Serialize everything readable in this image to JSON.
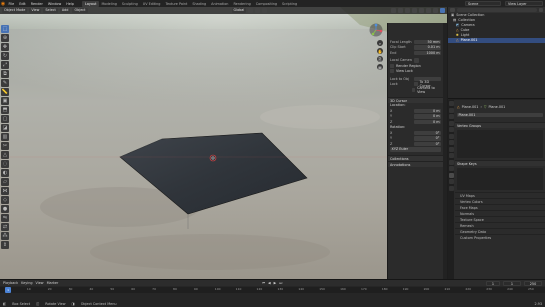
{
  "menu": [
    "File",
    "Edit",
    "Render",
    "Window",
    "Help"
  ],
  "workspaces": [
    {
      "label": "Layout",
      "active": true
    },
    {
      "label": "Modeling",
      "active": false
    },
    {
      "label": "Sculpting",
      "active": false
    },
    {
      "label": "UV Editing",
      "active": false
    },
    {
      "label": "Texture Paint",
      "active": false
    },
    {
      "label": "Shading",
      "active": false
    },
    {
      "label": "Animation",
      "active": false
    },
    {
      "label": "Rendering",
      "active": false
    },
    {
      "label": "Compositing",
      "active": false
    },
    {
      "label": "Scripting",
      "active": false
    }
  ],
  "topright": {
    "scene": "Scene",
    "view_layer": "View Layer"
  },
  "viewport_header": {
    "mode": "Object Mode",
    "view": "View",
    "select": "Select",
    "add": "Add",
    "object": "Object",
    "orientation": "Global"
  },
  "npanel": {
    "lens": [
      {
        "label": "Focal Length",
        "value": "50 mm"
      },
      {
        "label": "Clip Start",
        "value": "0.01 m"
      },
      {
        "label": "End",
        "value": "1000 m"
      }
    ],
    "local_camera": "Local Camera",
    "render_region": "Render Region",
    "view_lock": "View Lock",
    "lock_to_object": "Lock to Obj",
    "lock": "Lock",
    "to_3d_cursor": "To 3D Cursor",
    "camera_to_view": "Camera to View",
    "cursor_section": "3D Cursor",
    "location_label": "Location:",
    "location": [
      {
        "axis": "X",
        "value": "0 m"
      },
      {
        "axis": "Y",
        "value": "0 m"
      },
      {
        "axis": "Z",
        "value": "0 m"
      }
    ],
    "rotation_label": "Rotation:",
    "rotation": [
      {
        "axis": "X",
        "value": "0°"
      },
      {
        "axis": "Y",
        "value": "0°"
      },
      {
        "axis": "Z",
        "value": "0°"
      }
    ],
    "rotation_mode": "XYZ Euler",
    "collections": "Collections",
    "annotations": "Annotations"
  },
  "outliner": {
    "title": "Scene Collection",
    "rows": [
      {
        "label": "Collection",
        "selected": false
      },
      {
        "label": "Camera",
        "selected": false
      },
      {
        "label": "Cube",
        "selected": false
      },
      {
        "label": "Light",
        "selected": false
      },
      {
        "label": "Plane.001",
        "selected": true
      }
    ]
  },
  "properties": {
    "object_name": "Plane.001",
    "mesh_name": "Plane.001",
    "sections": [
      {
        "label": "Vertex Groups",
        "sub": false
      },
      {
        "label": "Shape Keys",
        "sub": false
      },
      {
        "label": "UV Maps",
        "sub": true
      },
      {
        "label": "Vertex Colors",
        "sub": true
      },
      {
        "label": "Face Maps",
        "sub": true
      },
      {
        "label": "Normals",
        "sub": true
      },
      {
        "label": "Texture Space",
        "sub": true
      },
      {
        "label": "Remesh",
        "sub": true
      },
      {
        "label": "Geometry Data",
        "sub": true
      },
      {
        "label": "Custom Properties",
        "sub": true
      }
    ]
  },
  "timeline": {
    "menu": [
      "Playback",
      "Keying",
      "View",
      "Marker"
    ],
    "current_frame": "1",
    "start": "1",
    "end": "250",
    "ticks": [
      "0",
      "10",
      "20",
      "30",
      "40",
      "50",
      "60",
      "70",
      "80",
      "90",
      "100",
      "110",
      "120",
      "130",
      "140",
      "150",
      "160",
      "170",
      "180",
      "190",
      "200",
      "210",
      "220",
      "230",
      "240",
      "250"
    ]
  },
  "statusbar": {
    "select": "Box Select",
    "rotate": "Rotate View",
    "menu": "Object Context Menu",
    "version": "2.93"
  },
  "colors": {
    "accent": "#4772b3",
    "selection": "#334d80",
    "playhead": "#4b83d6"
  }
}
